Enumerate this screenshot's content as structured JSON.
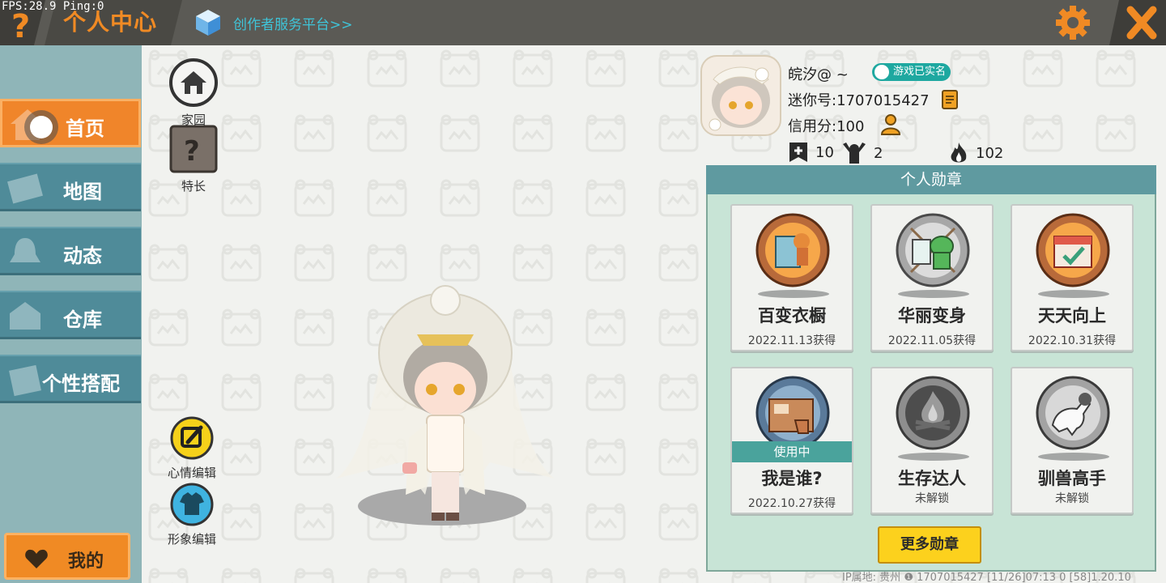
{
  "debug": {
    "fps_ping": "FPS:28.9  Ping:0"
  },
  "header": {
    "help_icon": "question-icon",
    "title": "个人中心",
    "creator_link": "创作者服务平台>>",
    "settings_icon": "gear-icon",
    "close_icon": "close-icon"
  },
  "sidebar": {
    "items": [
      {
        "label": "首页",
        "icon": "home-icon",
        "active": true
      },
      {
        "label": "地图",
        "icon": "map-icon",
        "active": false
      },
      {
        "label": "动态",
        "icon": "bell-icon",
        "active": false
      },
      {
        "label": "仓库",
        "icon": "warehouse-icon",
        "active": false
      },
      {
        "label": "个性搭配",
        "icon": "outfit-icon",
        "active": false
      }
    ],
    "mine_label": "我的"
  },
  "tools": {
    "home": "家园",
    "talent": "特长",
    "mood": "心情编辑",
    "appearance": "形象编辑"
  },
  "profile": {
    "name": "皖汐@ ~",
    "verified": "游戏已实名",
    "mini_id": "迷你号:1707015427",
    "credit": "信用分:100",
    "stats": {
      "flags": "10",
      "fans": "2",
      "heat": "102"
    }
  },
  "medals": {
    "title": "个人勋章",
    "items": [
      {
        "name": "百变衣橱",
        "date": "2022.11.13获得",
        "style": "bronze"
      },
      {
        "name": "华丽变身",
        "date": "2022.11.05获得",
        "style": "silver"
      },
      {
        "name": "天天向上",
        "date": "2022.10.31获得",
        "style": "bronze"
      },
      {
        "name": "我是谁?",
        "date": "2022.10.27获得",
        "style": "steel",
        "in_use": "使用中"
      },
      {
        "name": "生存达人",
        "date": "未解锁",
        "style": "locked"
      },
      {
        "name": "驯兽高手",
        "date": "未解锁",
        "style": "locked"
      }
    ],
    "more_button": "更多勋章"
  },
  "footer": "IP属地: 贵州 ❶     1707015427    [11/26]07:13 0  [58]1.20.10",
  "colors": {
    "accent": "#f08a24",
    "teal": "#4f8b99",
    "panel": "#c8e4d6"
  }
}
